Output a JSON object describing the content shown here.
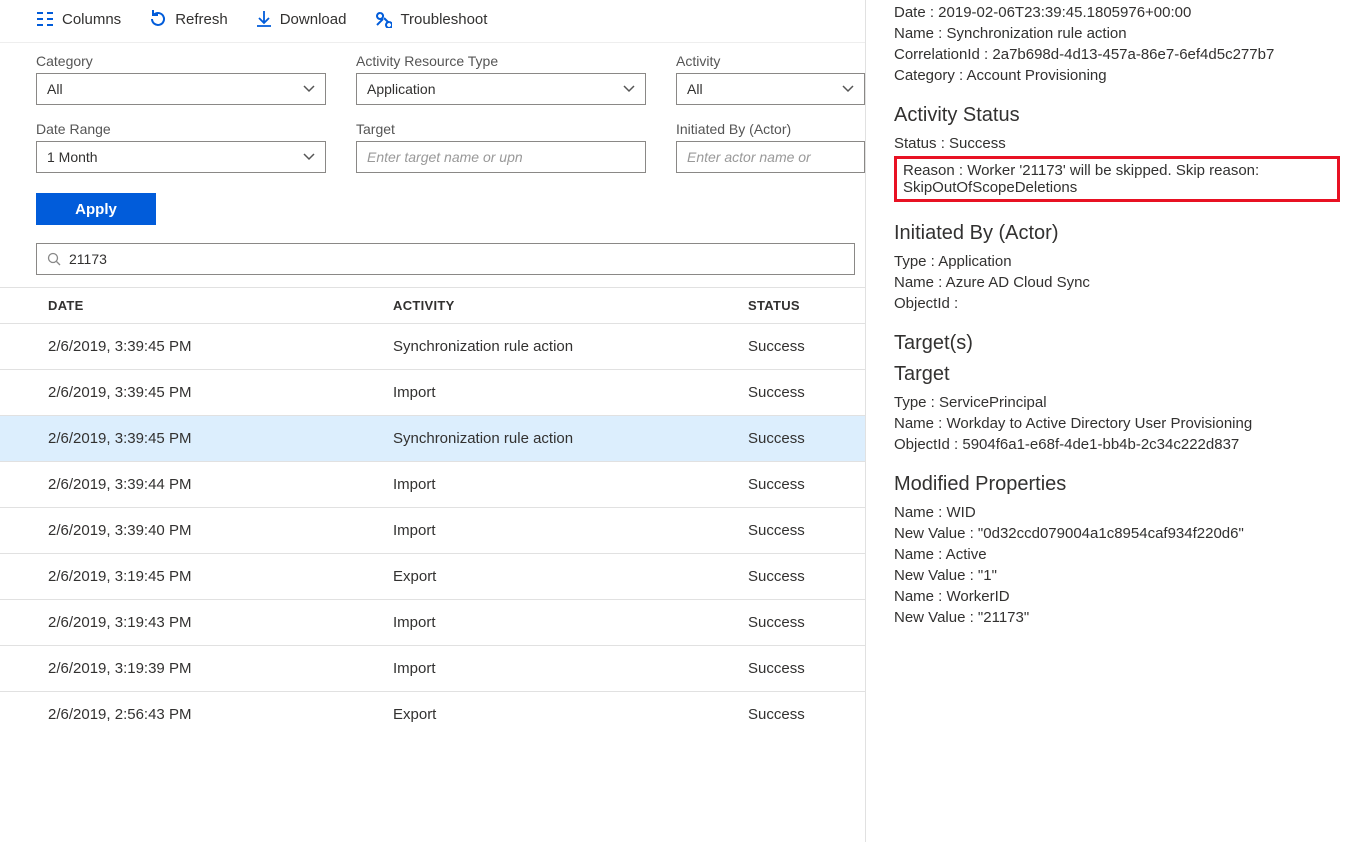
{
  "toolbar": {
    "columns": "Columns",
    "refresh": "Refresh",
    "download": "Download",
    "troubleshoot": "Troubleshoot"
  },
  "filters": {
    "category_label": "Category",
    "category_value": "All",
    "resource_label": "Activity Resource Type",
    "resource_value": "Application",
    "activity_label": "Activity",
    "activity_value": "All",
    "daterange_label": "Date Range",
    "daterange_value": "1 Month",
    "target_label": "Target",
    "target_placeholder": "Enter target name or upn",
    "initiated_label": "Initiated By (Actor)",
    "initiated_placeholder": "Enter actor name or",
    "apply": "Apply"
  },
  "search_value": "21173",
  "table": {
    "headers": {
      "date": "DATE",
      "activity": "ACTIVITY",
      "status": "STATUS"
    },
    "rows": [
      {
        "date": "2/6/2019, 3:39:45 PM",
        "activity": "Synchronization rule action",
        "status": "Success",
        "selected": false
      },
      {
        "date": "2/6/2019, 3:39:45 PM",
        "activity": "Import",
        "status": "Success",
        "selected": false
      },
      {
        "date": "2/6/2019, 3:39:45 PM",
        "activity": "Synchronization rule action",
        "status": "Success",
        "selected": true
      },
      {
        "date": "2/6/2019, 3:39:44 PM",
        "activity": "Import",
        "status": "Success",
        "selected": false
      },
      {
        "date": "2/6/2019, 3:39:40 PM",
        "activity": "Import",
        "status": "Success",
        "selected": false
      },
      {
        "date": "2/6/2019, 3:19:45 PM",
        "activity": "Export",
        "status": "Success",
        "selected": false
      },
      {
        "date": "2/6/2019, 3:19:43 PM",
        "activity": "Import",
        "status": "Success",
        "selected": false
      },
      {
        "date": "2/6/2019, 3:19:39 PM",
        "activity": "Import",
        "status": "Success",
        "selected": false
      },
      {
        "date": "2/6/2019, 2:56:43 PM",
        "activity": "Export",
        "status": "Success",
        "selected": false
      }
    ]
  },
  "details": {
    "date": "Date : 2019-02-06T23:39:45.1805976+00:00",
    "name": "Name : Synchronization rule action",
    "correlation": "CorrelationId : 2a7b698d-4d13-457a-86e7-6ef4d5c277b7",
    "category": "Category : Account Provisioning",
    "activity_status_heading": "Activity Status",
    "status": "Status : Success",
    "reason": "Reason : Worker '21173' will be skipped. Skip reason: SkipOutOfScopeDeletions",
    "initiated_heading": "Initiated By (Actor)",
    "actor_type": "Type : Application",
    "actor_name": "Name : Azure AD Cloud Sync",
    "actor_objid": "ObjectId :",
    "targets_heading": "Target(s)",
    "target_heading": "Target",
    "target_type": "Type : ServicePrincipal",
    "target_name": "Name : Workday to Active Directory User Provisioning",
    "target_objid": "ObjectId : 5904f6a1-e68f-4de1-bb4b-2c34c222d837",
    "modprops_heading": "Modified Properties",
    "mp1_name": "Name : WID",
    "mp1_val": "New Value : \"0d32ccd079004a1c8954caf934f220d6\"",
    "mp2_name": "Name : Active",
    "mp2_val": "New Value : \"1\"",
    "mp3_name": "Name : WorkerID",
    "mp3_val": "New Value : \"21173\""
  }
}
